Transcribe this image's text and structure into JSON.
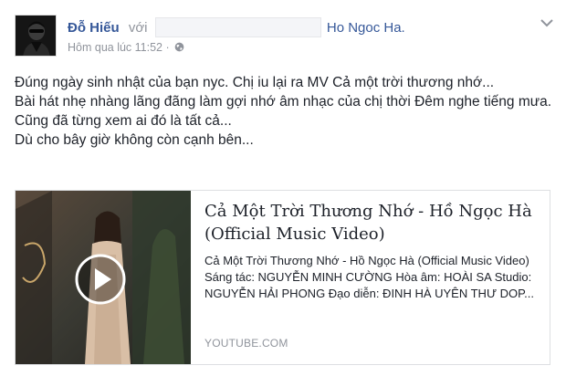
{
  "post": {
    "author": "Đỗ Hiếu",
    "with_label": "với",
    "tagged_name": "Ho Ngoc Ha.",
    "timestamp": "Hôm qua lúc 11:52",
    "separator": "·",
    "privacy_icon": "globe-icon",
    "menu_icon": "chevron-down-icon",
    "body_lines": [
      "Đúng ngày sinh nhật của bạn nyc. Chị iu lại ra MV Cả một trời thương nhớ...",
      "Bài hát nhẹ nhàng lãng đãng làm gợi nhớ âm nhạc của chị thời Đêm nghe tiếng mưa.",
      "Cũng đã từng xem ai đó là tất cả...",
      "Dù cho bây giờ không còn cạnh bên..."
    ]
  },
  "link_card": {
    "title": "Cả Một Trời Thương Nhớ - Hồ Ngọc Hà (Official Music Video)",
    "description": "Cả Một Trời Thương Nhớ - Hồ Ngọc Hà (Official Music Video) Sáng tác: NGUYỄN MINH CƯỜNG Hòa âm: HOÀI SA Studio: NGUYỄN HẢI PHONG Đạo diễn: ĐINH HÀ UYÊN THƯ DOP...",
    "domain": "YOUTUBE.COM",
    "thumbnail_icon": "play-icon"
  },
  "colors": {
    "link": "#365899",
    "muted": "#90949c",
    "text": "#1d2129",
    "border": "#dddfe2"
  }
}
